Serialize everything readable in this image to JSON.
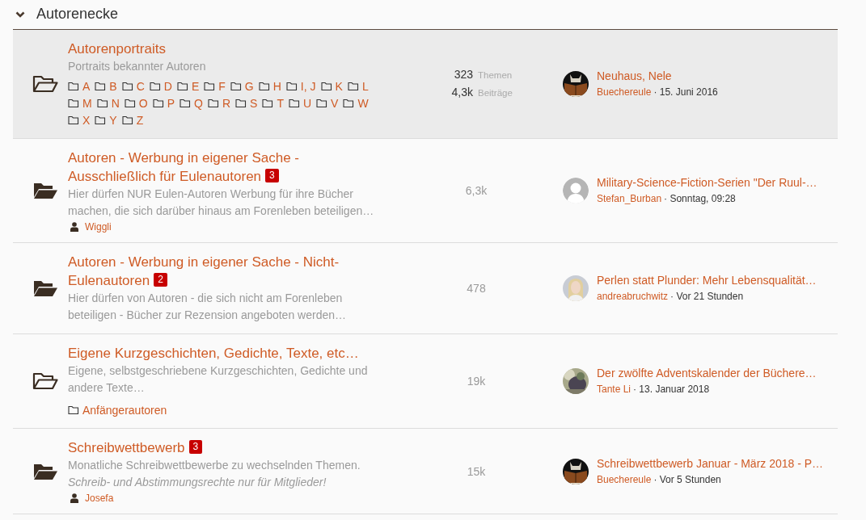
{
  "section": {
    "title": "Autorenecke",
    "expanded": true
  },
  "forums": [
    {
      "title": "Autorenportraits",
      "unread": false,
      "highlighted": true,
      "description": "Portraits bekannter Autoren",
      "subforums": [
        "A",
        "B",
        "C",
        "D",
        "E",
        "F",
        "G",
        "H",
        "I, J",
        "K",
        "L",
        "M",
        "N",
        "O",
        "P",
        "Q",
        "R",
        "S",
        "T",
        "U",
        "V",
        "W",
        "X",
        "Y",
        "Z"
      ],
      "stats": {
        "kind": "split",
        "threads": "323",
        "threads_label": "Themen",
        "posts": "4,3k",
        "posts_label": "Beiträge"
      },
      "last_post": {
        "title": "Neuhaus, Nele",
        "user": "Buechereule",
        "date": "· 15. Juni 2016"
      }
    },
    {
      "title": "Autoren - Werbung in eigener Sache - Ausschließlich für Eulenautoren",
      "badge": "3",
      "unread": true,
      "highlighted": false,
      "description": "Hier dürfen NUR Eulen-Autoren Werbung für ihre Bücher machen, die sich darüber hinaus am Forenleben beteiligen…",
      "moderator": "Wiggli",
      "stats": {
        "kind": "single",
        "count": "6,3k"
      },
      "last_post": {
        "avatar": {
          "kind": "default"
        },
        "title": "Military-Science-Fiction-Serien \"Der Ruul-…",
        "user": "Stefan_Burban",
        "date": "· Sonntag, 09:28"
      }
    },
    {
      "title": "Autoren - Werbung in eigener Sache - Nicht-Eulenautoren",
      "badge": "2",
      "unread": true,
      "highlighted": false,
      "description": "Hier dürfen von Autoren - die sich nicht am Forenleben beteiligen - Bücher zur Rezension angeboten werden…",
      "stats": {
        "kind": "single",
        "count": "478"
      },
      "last_post": {
        "title": "Perlen statt Plunder: Mehr Lebensqualität…",
        "user": "andreabruchwitz",
        "date": "· Vor 21 Stunden"
      }
    },
    {
      "title": "Eigene Kurzgeschichten, Gedichte, Texte, etc…",
      "unread": false,
      "highlighted": false,
      "description": "Eigene, selbstgeschriebene Kurzgeschichten, Gedichte und andere Texte…",
      "subforums": [
        "Anfängerautoren"
      ],
      "stats": {
        "kind": "single",
        "count": "19k"
      },
      "last_post": {
        "title": "Der zwölfte Adventskalender der Büchere…",
        "user": "Tante Li",
        "date": "· 13. Januar 2018"
      }
    },
    {
      "title": "Schreibwettbewerb",
      "badge": "3",
      "unread": true,
      "highlighted": false,
      "description": "Monatliche Schreibwettbewerbe zu wechselnden Themen.",
      "note": "Schreib- und Abstimmungsrechte nur für Mitglieder!",
      "moderator": "Josefa",
      "stats": {
        "kind": "single",
        "count": "15k"
      },
      "last_post": {
        "title": "Schreibwettbewerb Januar - März 2018 - P…",
        "user": "Buechereule",
        "date": "· Vor 5 Stunden"
      }
    }
  ]
}
